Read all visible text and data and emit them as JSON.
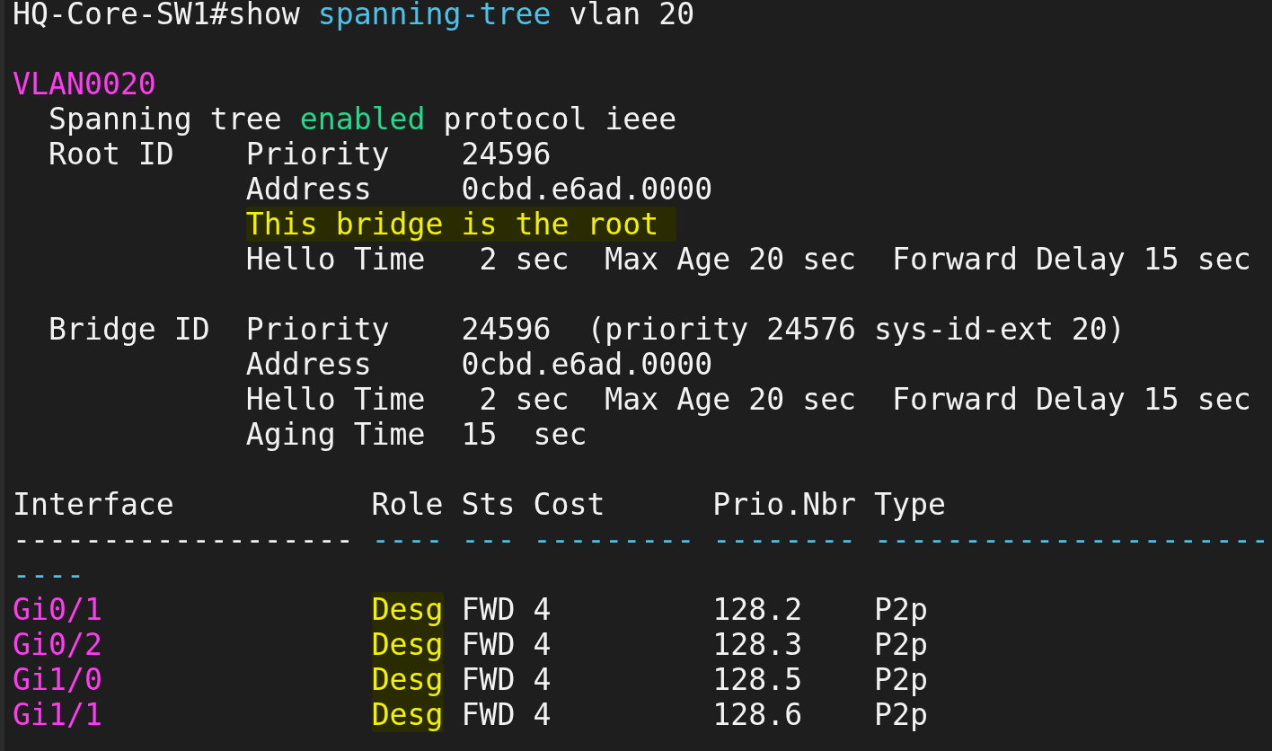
{
  "terminal": {
    "lines": [
      {
        "kind": "text",
        "segments": [
          {
            "text": "HQ-Core-SW1#show "
          },
          {
            "text": "spanning-tree",
            "color": "#4cc2e8"
          },
          {
            "text": " vlan 20"
          }
        ]
      },
      {
        "kind": "blank"
      },
      {
        "kind": "text",
        "segments": [
          {
            "text": "VLAN0020",
            "color": "#ff3cf0"
          }
        ]
      },
      {
        "kind": "text",
        "segments": [
          {
            "text": "  Spanning tree "
          },
          {
            "text": "enabled",
            "color": "#25d98c"
          },
          {
            "text": " protocol ieee"
          }
        ]
      },
      {
        "kind": "text",
        "segments": [
          {
            "text": "  Root ID    Priority    24596"
          }
        ]
      },
      {
        "kind": "text",
        "segments": [
          {
            "text": "             Address     0cbd.e6ad.0000"
          }
        ]
      },
      {
        "kind": "text",
        "segments": [
          {
            "text": "             This bridge is the root ",
            "highlight": true
          }
        ]
      },
      {
        "kind": "text",
        "segments": [
          {
            "text": "             Hello Time   2 sec  Max Age 20 sec  Forward Delay 15 sec"
          }
        ]
      },
      {
        "kind": "blank"
      },
      {
        "kind": "text",
        "segments": [
          {
            "text": "  Bridge ID  Priority    24596  (priority 24576 sys-id-ext 20)"
          }
        ]
      },
      {
        "kind": "text",
        "segments": [
          {
            "text": "             Address     0cbd.e6ad.0000"
          }
        ]
      },
      {
        "kind": "text",
        "segments": [
          {
            "text": "             Hello Time   2 sec  Max Age 20 sec  Forward Delay 15 sec"
          }
        ]
      },
      {
        "kind": "text",
        "segments": [
          {
            "text": "             Aging Time  15  sec"
          }
        ]
      },
      {
        "kind": "blank"
      },
      {
        "kind": "text",
        "segments": [
          {
            "text": "Interface           Role Sts Cost      Prio.Nbr Type"
          }
        ]
      },
      {
        "kind": "text",
        "segments": [
          {
            "text": "------------------- "
          },
          {
            "text": "---- --- --------- -------- ----------------------",
            "color": "#4cc2e8"
          }
        ]
      },
      {
        "kind": "text",
        "segments": [
          {
            "text": "----",
            "color": "#4cc2e8"
          }
        ]
      },
      {
        "kind": "text",
        "segments": [
          {
            "text": "Gi0/1",
            "color": "#ff3cf0"
          },
          {
            "text": "               Desg",
            "highlight": true
          },
          {
            "text": " FWD 4         128.2    P2p"
          }
        ]
      },
      {
        "kind": "text",
        "segments": [
          {
            "text": "Gi0/2",
            "color": "#ff3cf0"
          },
          {
            "text": "               Desg",
            "highlight": true
          },
          {
            "text": " FWD 4         128.3    P2p"
          }
        ]
      },
      {
        "kind": "text",
        "segments": [
          {
            "text": "Gi1/0",
            "color": "#ff3cf0"
          },
          {
            "text": "               Desg",
            "highlight": true
          },
          {
            "text": " FWD 4         128.5    P2p"
          }
        ]
      },
      {
        "kind": "text",
        "segments": [
          {
            "text": "Gi1/1",
            "color": "#ff3cf0"
          },
          {
            "text": "               Desg",
            "highlight": true
          },
          {
            "text": " FWD 4         128.6    P2p"
          }
        ]
      }
    ]
  }
}
